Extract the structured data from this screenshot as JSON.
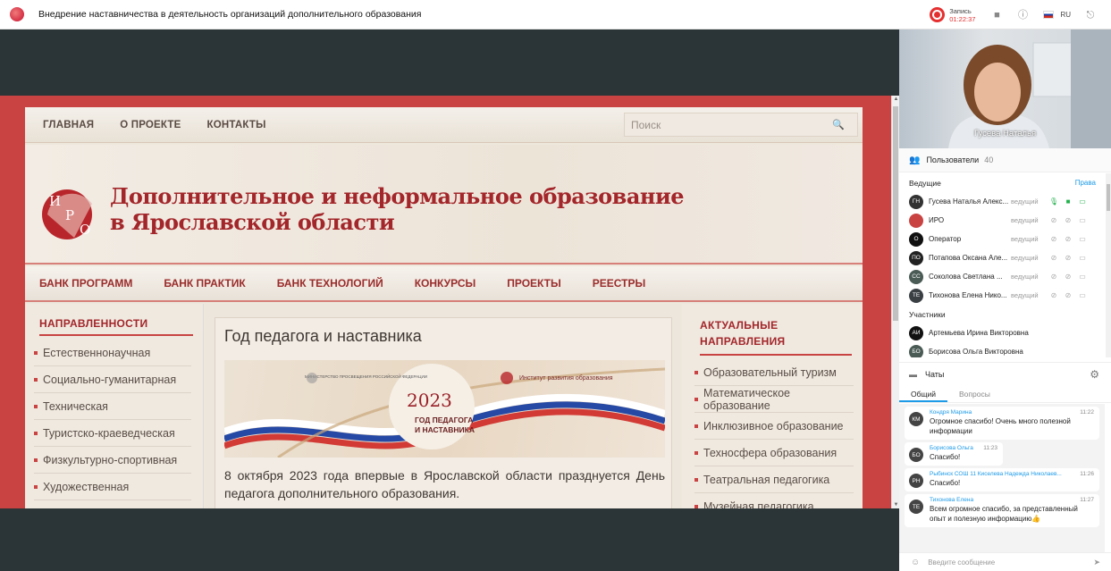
{
  "window": {
    "title": "Внедрение наставничества в деятельность организаций дополнительного образования",
    "record_label": "Запись",
    "record_time": "01:22:37",
    "lang": "RU"
  },
  "site": {
    "top_menu": [
      "ГЛАВНАЯ",
      "О ПРОЕКТЕ",
      "КОНТАКТЫ"
    ],
    "search_placeholder": "Поиск",
    "logo_text": "ИРО",
    "banner_line1": "Дополнительное и неформальное образование",
    "banner_line2": "в Ярославской области",
    "main_menu": [
      "БАНК ПРОГРАММ",
      "БАНК ПРАКТИК",
      "БАНК ТЕХНОЛОГИЙ",
      "КОНКУРСЫ",
      "ПРОЕКТЫ",
      "РЕЕСТРЫ"
    ],
    "left_head": "НАПРАВЛЕННОСТИ",
    "left_items": [
      "Естественнонаучная",
      "Социально-гуманитарная",
      "Техническая",
      "Туристско-краеведческая",
      "Физкультурно-спортивная",
      "Художественная"
    ],
    "news_title": "Год педагога и наставника",
    "news_img_ministry": "МИНИСТЕРСТВО ПРОСВЕЩЕНИЯ РОССИЙСКОЙ ФЕДЕРАЦИИ",
    "news_img_institute": "Институт развития образования",
    "news_img_year": "2023",
    "news_img_caption1": "ГОД ПЕДАГОГА",
    "news_img_caption2": "И НАСТАВНИКА",
    "news_text": "8 октября 2023 года впервые в Ярославской области празднуется День педагога дополнительного образования.",
    "right_head": "АКТУАЛЬНЫЕ НАПРАВЛЕНИЯ",
    "right_items": [
      "Образовательный туризм",
      "Математическое образование",
      "Инклюзивное образование",
      "Техносфера образования",
      "Театральная педагогика",
      "Музейная педагогика"
    ]
  },
  "video": {
    "name": "Гусева Наталья"
  },
  "users": {
    "label": "Пользователи",
    "count": "40",
    "hosts_label": "Ведущие",
    "rights_label": "Права",
    "participants_label": "Участники",
    "hosts": [
      {
        "initials": "ГН",
        "name": "Гусева Наталья Алекс...",
        "role": "ведущий"
      },
      {
        "initials": "",
        "name": "ИРО",
        "role": "ведущий"
      },
      {
        "initials": "О",
        "name": "Оператор",
        "role": "ведущий"
      },
      {
        "initials": "ПО",
        "name": "Потапова Оксана Але...",
        "role": "ведущий"
      },
      {
        "initials": "СС",
        "name": "Соколова Светлана ...",
        "role": "ведущий"
      },
      {
        "initials": "ТЕ",
        "name": "Тихонова Елена Нико...",
        "role": "ведущий"
      }
    ],
    "participants": [
      {
        "initials": "АИ",
        "name": "Артемьева Ирина Викторовна"
      },
      {
        "initials": "БО",
        "name": "Борисова Ольга Викторовна"
      }
    ]
  },
  "chat": {
    "label": "Чаты",
    "tab_general": "Общий",
    "tab_questions": "Вопросы",
    "messages": [
      {
        "initials": "КМ",
        "author": "Кондря Марина",
        "time": "11:22",
        "text": "Огромное спасибо! Очень много полезной информации"
      },
      {
        "initials": "БО",
        "author": "Борисова Ольга",
        "time": "11:23",
        "text": "Спасибо!"
      },
      {
        "initials": "РН",
        "author": "Рыбинск СОШ 11 Киселева Надежда Николаев...",
        "time": "11:26",
        "text": "Спасибо!"
      },
      {
        "initials": "ТЕ",
        "author": "Тихонова Елена",
        "time": "11:27",
        "text": "Всем огромное спасибо, за представленный опыт и полезную информацию👍"
      }
    ],
    "input_placeholder": "Введите сообщение"
  }
}
